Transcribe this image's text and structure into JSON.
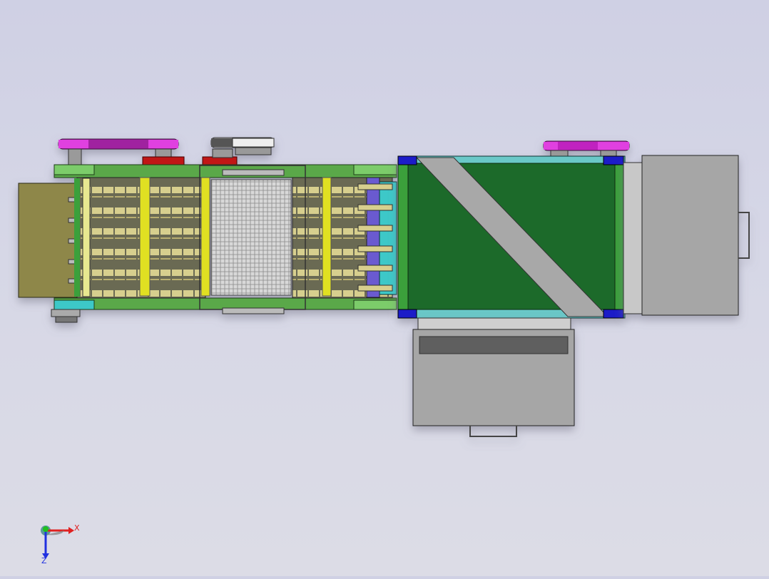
{
  "viewport": {
    "background_top": "#cfd0e4",
    "background_bottom": "#dcdce6"
  },
  "model": {
    "colors": {
      "frame_green": "#5aa84a",
      "belt_dark_green": "#1f6b2c",
      "cyan_guard": "#3ec8c8",
      "olive_housing": "#8e874a",
      "tan_rollers": "#c9c08a",
      "yellow_beam": "#e0e020",
      "magenta_motor": "#c020c0",
      "red_bracket": "#c01818",
      "blue_bearing": "#1a1ac8",
      "grey_hopper": "#a6a6a6",
      "purple_rollers": "#6a5ad0"
    }
  },
  "triad": {
    "x_label": "X",
    "z_label": "Z",
    "x_color": "#e02020",
    "y_color": "#20c020",
    "z_color": "#2030e0"
  }
}
